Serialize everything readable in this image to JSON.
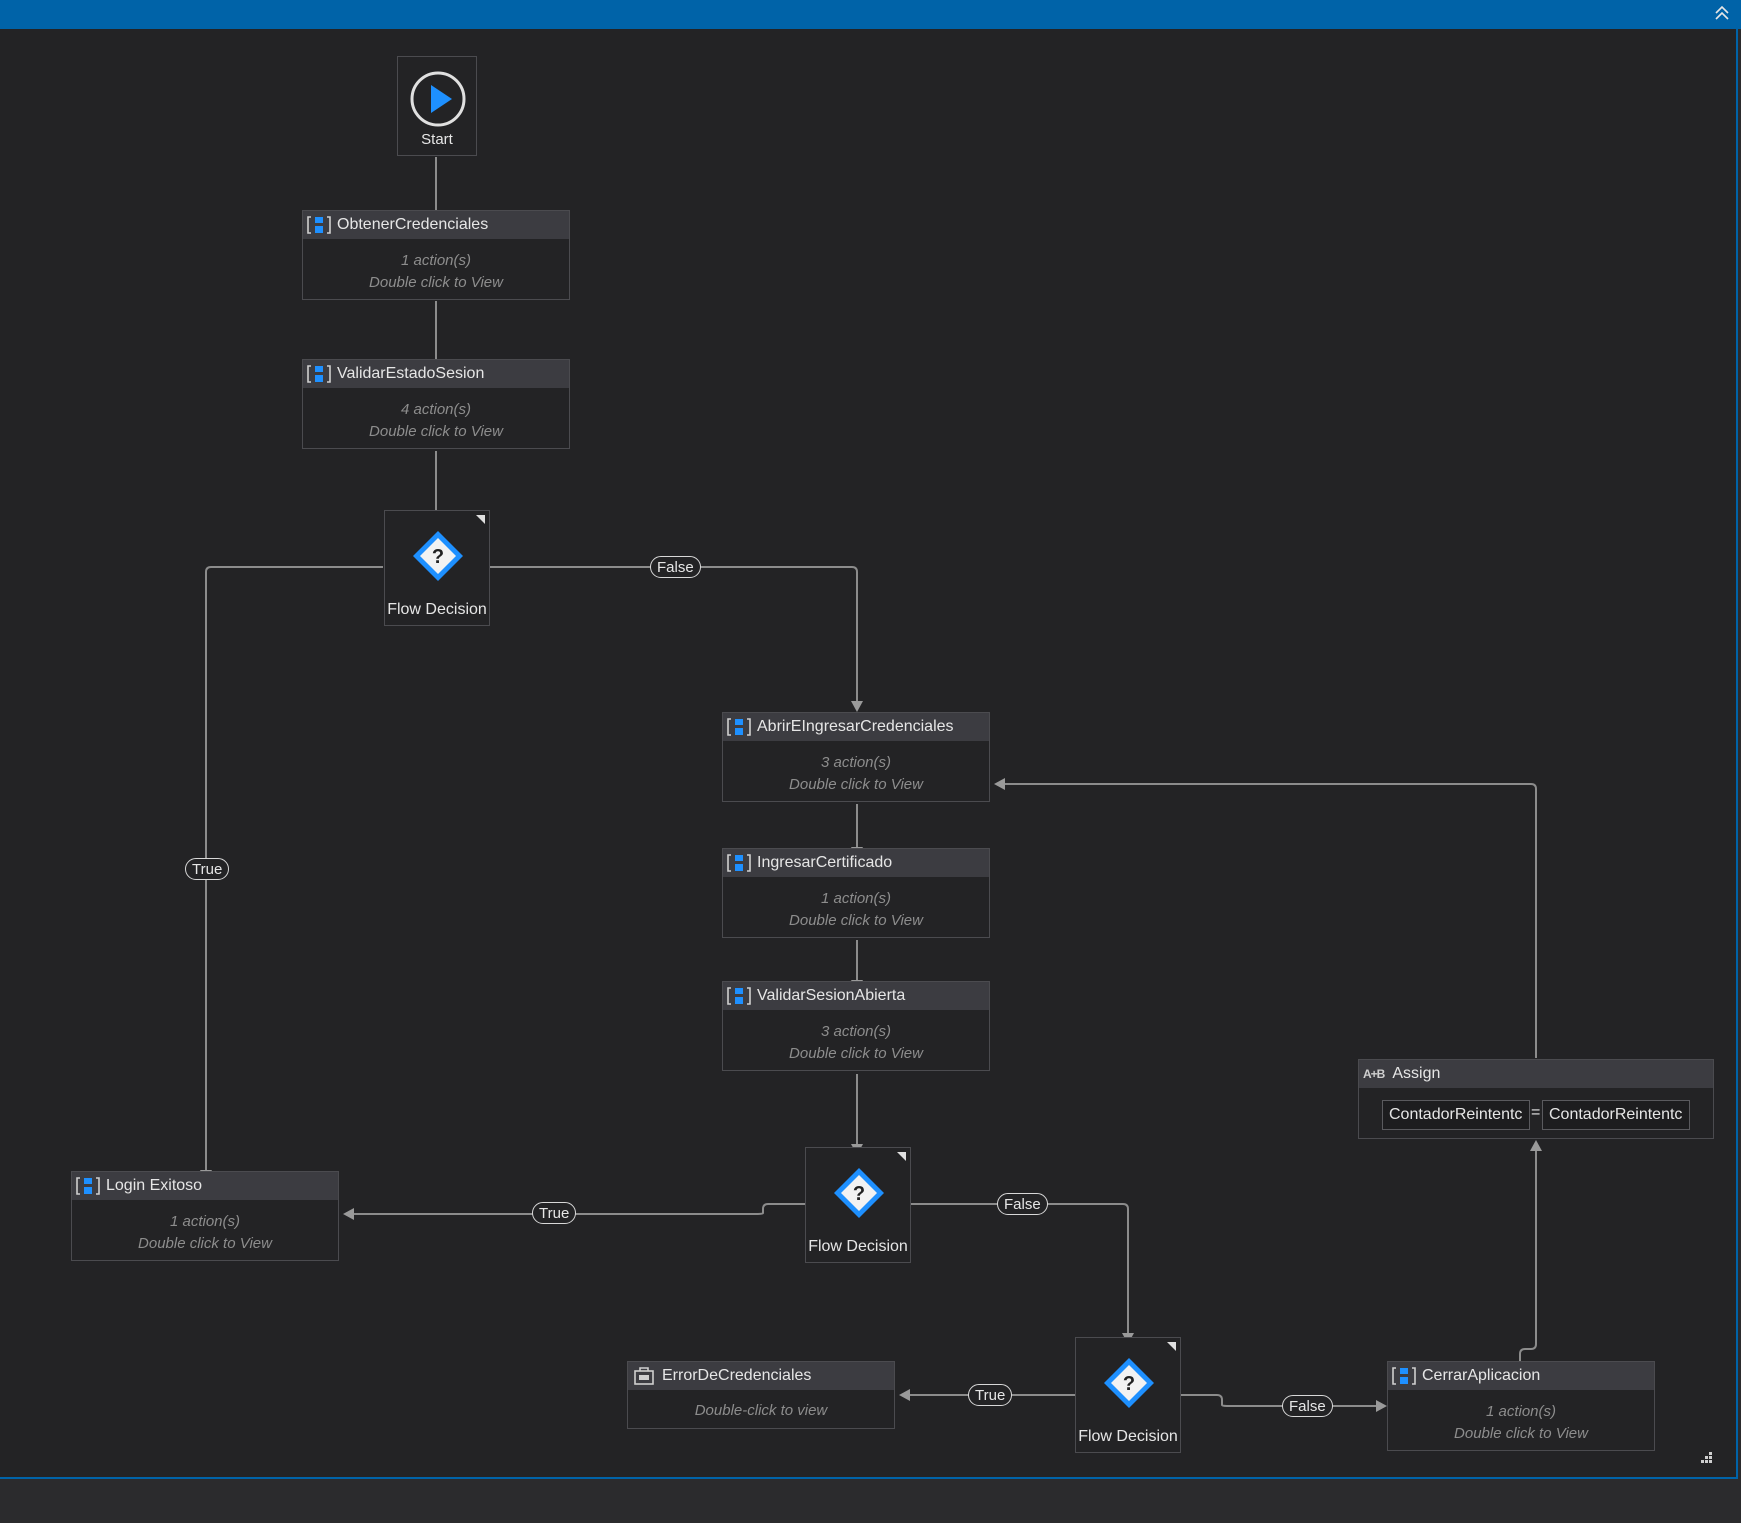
{
  "start": {
    "label": "Start"
  },
  "sequences": [
    {
      "name": "ObtenerCredenciales",
      "count": "1 action(s)",
      "hint": "Double click to View"
    },
    {
      "name": "ValidarEstadoSesion",
      "count": "4 action(s)",
      "hint": "Double click to View"
    },
    {
      "name": "AbrirEIngresarCredenciales",
      "count": "3 action(s)",
      "hint": "Double click to View"
    },
    {
      "name": "IngresarCertificado",
      "count": "1 action(s)",
      "hint": "Double click to View"
    },
    {
      "name": "ValidarSesionAbierta",
      "count": "3 action(s)",
      "hint": "Double click to View"
    },
    {
      "name": "Login Exitoso",
      "count": "1 action(s)",
      "hint": "Double click to View"
    },
    {
      "name": "CerrarAplicacion",
      "count": "1 action(s)",
      "hint": "Double click to View"
    }
  ],
  "error_activity": {
    "name": "ErrorDeCredenciales",
    "hint": "Double-click to view"
  },
  "decisions": [
    {
      "label": "Flow Decision"
    },
    {
      "label": "Flow Decision"
    },
    {
      "label": "Flow Decision"
    }
  ],
  "assign": {
    "title": "Assign",
    "to": "ContadorReintentc",
    "value": "ContadorReintentc",
    "icon_text": "A+B"
  },
  "edge_labels": {
    "true": "True",
    "false": "False"
  },
  "icons": {
    "sequence": "sequence-icon",
    "decision": "question-diamond-icon",
    "start": "play-icon",
    "collapse": "chevron-up-icon",
    "fit": "fit-to-screen-icon",
    "error": "briefcase-icon"
  },
  "colors": {
    "accent": "#0063a8",
    "canvas": "#232325",
    "icon_blue": "#1e90ff"
  }
}
